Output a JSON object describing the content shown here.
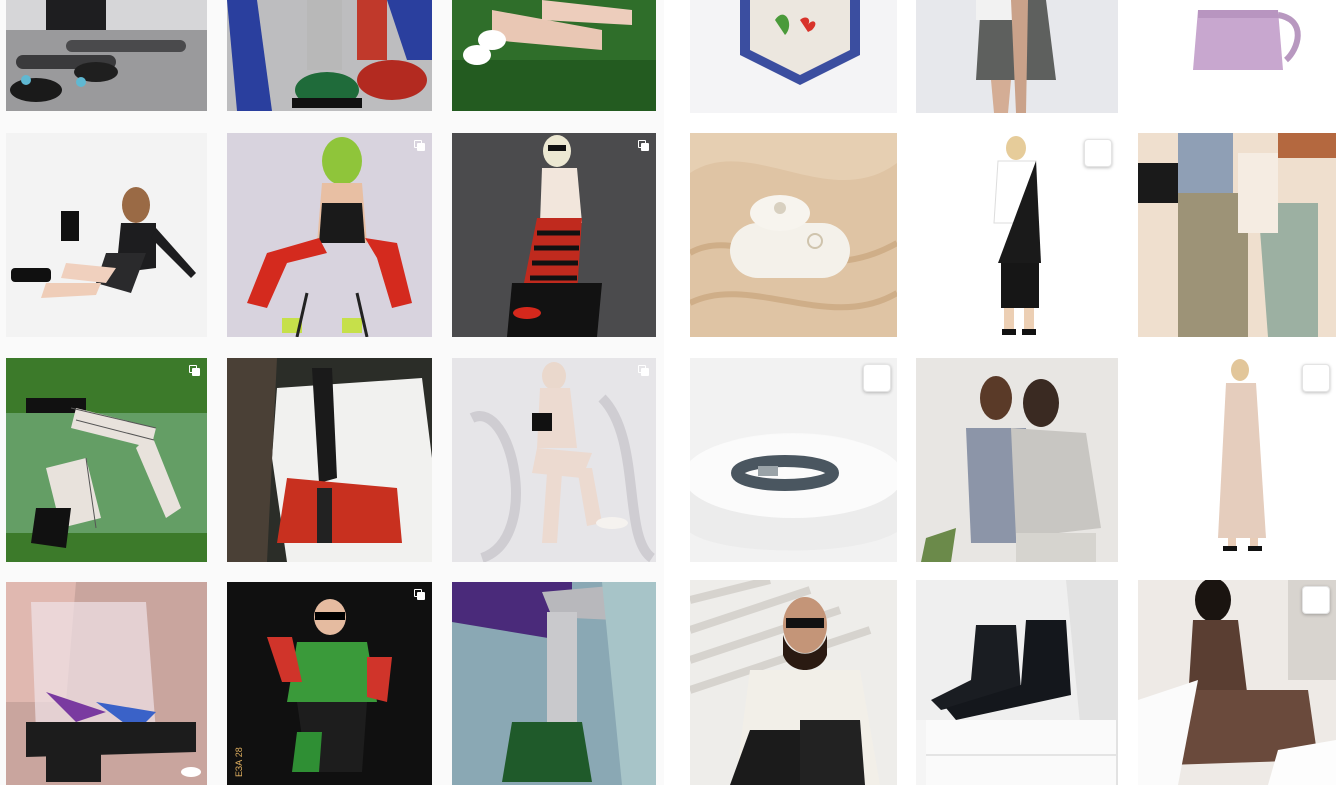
{
  "gallery": {
    "left_feed": {
      "tiles": [
        {
          "id": "l-r1-c1",
          "subject": "skateboard-shoes",
          "multi": false
        },
        {
          "id": "l-r1-c2",
          "subject": "glitter-legs-green-boots",
          "multi": false
        },
        {
          "id": "l-r1-c3",
          "subject": "legs-on-grass",
          "multi": false
        },
        {
          "id": "l-r2-c1",
          "subject": "model-lying-black-outfit",
          "multi": false
        },
        {
          "id": "l-r2-c2",
          "subject": "green-face-red-tights",
          "multi": true
        },
        {
          "id": "l-r2-c3",
          "subject": "model-striped-skirt",
          "multi": true
        },
        {
          "id": "l-r3-c1",
          "subject": "fishnet-legs-green",
          "multi": true
        },
        {
          "id": "l-r3-c2",
          "subject": "white-tee-red-bag",
          "multi": false
        },
        {
          "id": "l-r3-c3",
          "subject": "figure-white-drape",
          "multi": true
        },
        {
          "id": "l-r4-c1",
          "subject": "clear-platform-boot",
          "multi": false
        },
        {
          "id": "l-r4-c2",
          "subject": "green-outfit-sunglasses",
          "multi": true
        },
        {
          "id": "l-r4-c3",
          "subject": "sparkle-leg-green-boot",
          "multi": false
        }
      ]
    },
    "right_feed": {
      "tiles": [
        {
          "id": "r-r1-c1",
          "subject": "embroidered-pennant",
          "selectable": false
        },
        {
          "id": "r-r1-c2",
          "subject": "grey-skirt-bag",
          "selectable": false
        },
        {
          "id": "r-r1-c3",
          "subject": "lilac-backpack",
          "selectable": false
        },
        {
          "id": "r-r2-c1",
          "subject": "ring-box-silk",
          "selectable": false
        },
        {
          "id": "r-r2-c2",
          "subject": "black-white-dress",
          "selectable": true
        },
        {
          "id": "r-r2-c3",
          "subject": "abstract-shapes",
          "selectable": false
        },
        {
          "id": "r-r3-c1",
          "subject": "leather-belt-pedestal",
          "selectable": true
        },
        {
          "id": "r-r3-c2",
          "subject": "two-models-grey",
          "selectable": false
        },
        {
          "id": "r-r3-c3",
          "subject": "beige-long-dress",
          "selectable": true
        },
        {
          "id": "r-r4-c1",
          "subject": "man-glasses-shadows",
          "selectable": false
        },
        {
          "id": "r-r4-c2",
          "subject": "chelsea-boots",
          "selectable": false
        },
        {
          "id": "r-r4-c3",
          "subject": "brown-slip-dress",
          "selectable": true
        }
      ]
    },
    "overlay_text": {
      "l-r4-c2": "ЕЗА 28"
    }
  }
}
